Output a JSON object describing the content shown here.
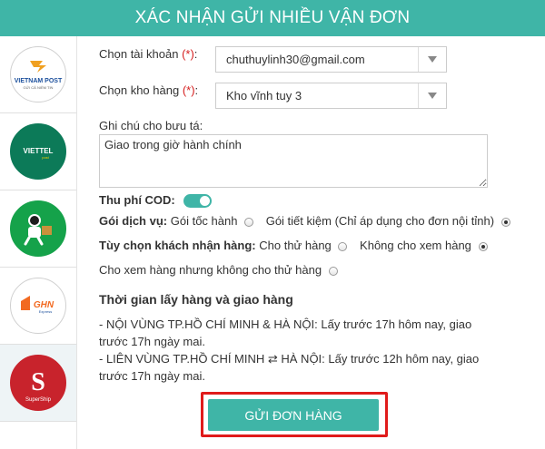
{
  "header": {
    "title": "XÁC NHẬN GỬI NHIỀU VẬN ĐƠN"
  },
  "carriers": [
    {
      "icon": "vietnam-post-logo",
      "name": "VIETNAM POST",
      "tagline": "GỬI CẢ NIỀM TIN",
      "color": "#f0a020"
    },
    {
      "icon": "viettel-logo",
      "name": "VIETTEL",
      "tagline": "post",
      "color": "#0c7a58"
    },
    {
      "icon": "delivery-man-logo",
      "color": "#15a24a"
    },
    {
      "icon": "ghn-logo",
      "name": "GHN",
      "tagline": "Express",
      "color": "#f26a21"
    },
    {
      "icon": "supership-logo",
      "name": "SuperShip",
      "letter": "S",
      "color": "#c8232c"
    }
  ],
  "form": {
    "account_label": "Chọn tài khoản",
    "account_required": "(*)",
    "account_value": "chuthuylinh30@gmail.com",
    "warehouse_label": "Chọn kho hàng",
    "warehouse_required": "(*)",
    "warehouse_value": "Kho vĩnh tuy 3",
    "note_label": "Ghi chú cho bưu tá:",
    "note_value": "Giao trong giờ hành chính",
    "cod_label": "Thu phí COD:",
    "service_label": "Gói dịch vụ:",
    "service_options": [
      "Gói tốc hành",
      "Gói tiết kiệm (Chỉ áp dụng cho đơn nội tỉnh)"
    ],
    "receive_label": "Tùy chọn khách nhận hàng:",
    "receive_options": [
      "Cho thử hàng",
      "Không cho xem hàng"
    ],
    "receive_option_3": "Cho xem hàng nhưng không cho thử hàng"
  },
  "info": {
    "title": "Thời gian lấy hàng và giao hàng",
    "line1": "- NỘI VÙNG TP.HỒ CHÍ MINH & HÀ NỘI: Lấy trước 17h hôm nay, giao trước 17h ngày mai.",
    "line2": "- LIÊN VÙNG TP.HỒ CHÍ MINH ⇄ HÀ NỘI: Lấy trước 12h hôm nay, giao trước 17h ngày mai."
  },
  "submit": {
    "label": "GỬI ĐƠN HÀNG"
  },
  "colors": {
    "accent": "#3fb5a7",
    "required": "#d62020",
    "highlight": "#e01b1b"
  }
}
